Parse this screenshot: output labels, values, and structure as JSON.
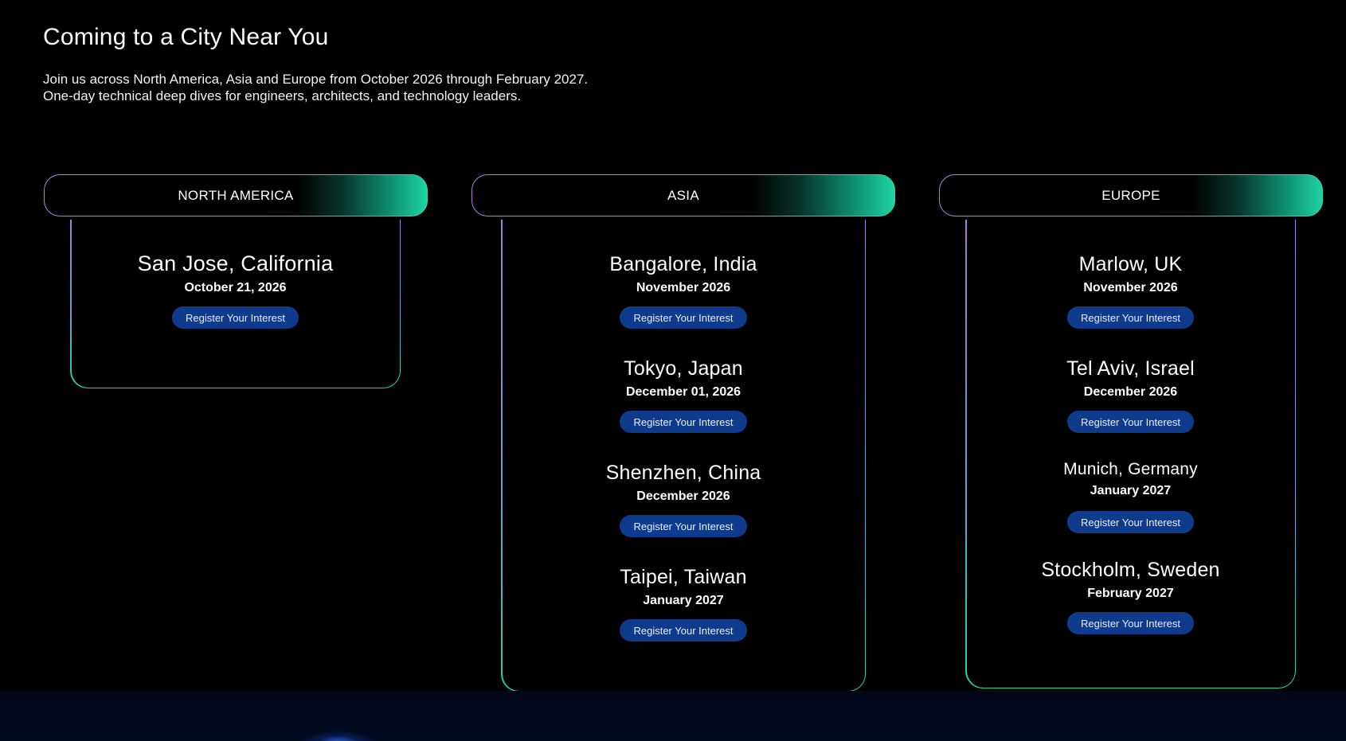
{
  "section": {
    "title": "Coming to a City Near You",
    "intro_line1": "Join us across North America, Asia and Europe from October 2026 through February 2027.",
    "intro_line2": "One-day technical deep dives for engineers, architects, and technology leaders."
  },
  "regions": [
    {
      "name": "NORTH AMERICA",
      "cities": [
        {
          "city": "San Jose, California",
          "date": "October 21, 2026",
          "button": "Register Your Interest"
        }
      ]
    },
    {
      "name": "ASIA",
      "cities": [
        {
          "city": "Bangalore, India",
          "date": "November 2026",
          "button": "Register Your Interest"
        },
        {
          "city": "Tokyo, Japan",
          "date": "December 01, 2026",
          "button": "Register Your Interest"
        },
        {
          "city": "Shenzhen, China",
          "date": "December 2026",
          "button": "Register Your Interest"
        },
        {
          "city": "Taipei, Taiwan",
          "date": "January 2027",
          "button": "Register Your Interest"
        }
      ]
    },
    {
      "name": "EUROPE",
      "cities": [
        {
          "city": "Marlow, UK",
          "date": "November 2026",
          "button": "Register Your Interest"
        },
        {
          "city": "Tel Aviv, Israel",
          "date": "December 2026",
          "button": "Register Your Interest"
        },
        {
          "city": "Munich, Germany",
          "date": "January 2027",
          "button": "Register Your Interest"
        },
        {
          "city": "Stockholm, Sweden",
          "date": "February 2027",
          "button": "Register Your Interest"
        }
      ]
    }
  ],
  "colors": {
    "background": "#000000",
    "button_bg": "#0e3b8c",
    "border_purple": "#a981d9",
    "border_teal": "#1fd3a2"
  }
}
